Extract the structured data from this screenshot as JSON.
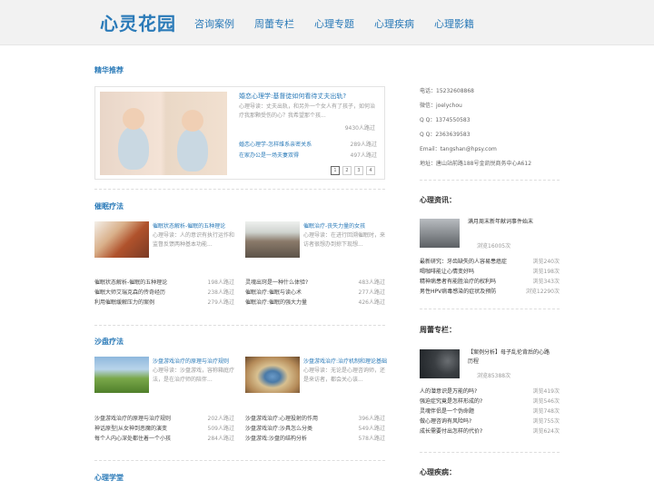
{
  "header": {
    "logo": "心灵花园",
    "nav": [
      "咨询案例",
      "周蕾专栏",
      "心理专题",
      "心理疾病",
      "心理影籍"
    ]
  },
  "featured": {
    "section_title": "精华推荐",
    "title": "婚恋心理学:基督徒如何看待丈夫出轨?",
    "desc": "心理导读：丈夫出轨，和另外一个女人有了孩子，如何治疗我那颗受伤的心？我希望那个孩...",
    "count": "9430人路过",
    "list": [
      {
        "t": "婚恋心理学-怎样维系亲密关系",
        "c": "289人路过"
      },
      {
        "t": "在家办公是一场夫妻双得",
        "c": "497人路过"
      }
    ],
    "pages": [
      "1",
      "2",
      "3",
      "4"
    ]
  },
  "hypnosis": {
    "section_title": "催眠疗法",
    "cards": [
      {
        "title": "催眠状态解析-催眠的五种理论",
        "desc": "心理导读：人的意识有执行运作和监督反馈两种基本功能..."
      },
      {
        "title": "催眠治疗-丧失力量的女孩",
        "desc": "心理导读：在进行回溯催眠时，来访者很想办到掠下现想..."
      }
    ],
    "left_rows": [
      {
        "t": "催眠状态解析-催眠的五种理论",
        "c": "198人路过"
      },
      {
        "t": "催眠大师艾瑞克森的传奇经历",
        "c": "238人路过"
      },
      {
        "t": "利用催眠缓解压力的案例",
        "c": "279人路过"
      }
    ],
    "right_rows": [
      {
        "t": "灵魂出窍是一种什么体验?",
        "c": "483人路过"
      },
      {
        "t": "催眠治疗:催眠与读心术",
        "c": "277人路过"
      },
      {
        "t": "催眠治疗:催眠的强大力量",
        "c": "426人路过"
      }
    ]
  },
  "sandplay": {
    "section_title": "沙盘疗法",
    "cards": [
      {
        "title": "沙盘游戏治疗的原理与治疗规则",
        "desc": "心理导读：沙盘游戏，容称箱庭疗法，是在治疗师的陪伴..."
      },
      {
        "title": "沙盘游戏治疗:治疗机制和理论基础",
        "desc": "心理导读：无论是心理咨询师，还是来访者，都会关心该..."
      }
    ],
    "left_rows": [
      {
        "t": "沙盘游戏治疗的原理与治疗规则",
        "c": "202人路过"
      },
      {
        "t": "神话原型|从女神到恶魔的演变",
        "c": "509人路过"
      },
      {
        "t": "每个人内心深处都住着一个小孩",
        "c": "284人路过"
      }
    ],
    "right_rows": [
      {
        "t": "沙盘游戏治疗:心理投射的作用",
        "c": "396人路过"
      },
      {
        "t": "沙盘游戏治疗:沙具怎么分类",
        "c": "549人路过"
      },
      {
        "t": "沙盘游戏:沙盘的结构分析",
        "c": "578人路过"
      }
    ]
  },
  "science": {
    "section_title": "心理学堂"
  },
  "sidebar": {
    "contact": [
      "电话：15232608868",
      "微信：joelychou",
      "Q Q：1374550583",
      "Q Q：2363639583",
      "Email：tangshan@hpsy.com",
      "地址：唐山站前路188号金凯悦商务中心A612"
    ],
    "news": {
      "heading": "心理资讯：",
      "feat_title": "满月周末新年献词事件始末",
      "feat_count": "浏览16005次",
      "rows": [
        {
          "t": "最新研究：牙齿缺失的人容易患癌症",
          "c": "浏览240次"
        },
        {
          "t": "喝咖啡能让心情变好吗",
          "c": "浏览198次"
        },
        {
          "t": "精神病患者有能胜治疗的权利吗",
          "c": "浏览343次"
        },
        {
          "t": "男性HPV病毒感染的症状及预防",
          "c": "浏览12290次"
        }
      ]
    },
    "column": {
      "heading": "周蕾专栏：",
      "feat_title": "【案例分析】母子乱伦背后的心路历程",
      "feat_count": "浏览85388次",
      "rows": [
        {
          "t": "人的潜意识是万能的吗?",
          "c": "浏览419次"
        },
        {
          "t": "强迫症究竟是怎样形成的?",
          "c": "浏览546次"
        },
        {
          "t": "灵魂伴侣是一个伪命题",
          "c": "浏览748次"
        },
        {
          "t": "做心理咨询有风险吗?",
          "c": "浏览755次"
        },
        {
          "t": "成长需要付出怎样的代价?",
          "c": "浏览624次"
        }
      ]
    },
    "disease": {
      "heading": "心理疾病："
    }
  }
}
